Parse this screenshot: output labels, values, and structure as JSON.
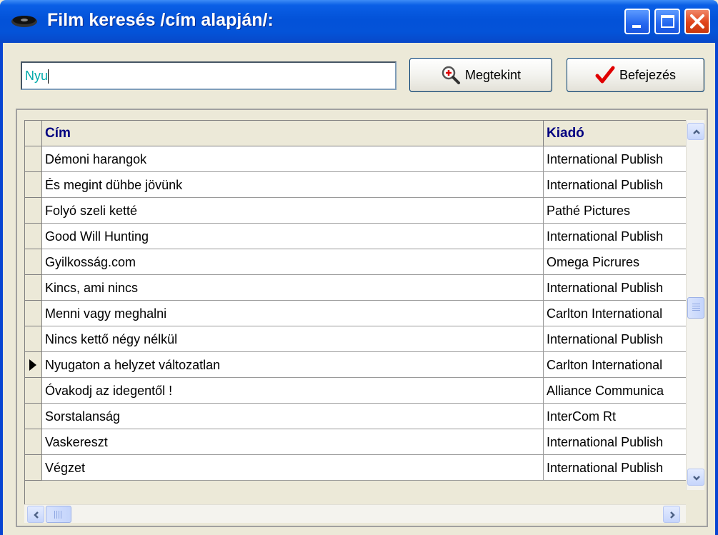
{
  "window": {
    "title": "Film keresés /cím alapján/:",
    "icons": {
      "app": "film-reel-icon",
      "minimize": "minimize-icon",
      "maximize": "maximize-icon",
      "close": "close-icon"
    }
  },
  "search": {
    "value": "Nyu"
  },
  "buttons": {
    "view_label": "Megtekint",
    "view_icon": "magnifier-icon",
    "done_label": "Befejezés",
    "done_icon": "checkmark-icon"
  },
  "table": {
    "columns": [
      "Cím",
      "Kiadó"
    ],
    "rows": [
      {
        "cim": "Démoni harangok",
        "kiado": "International Publish"
      },
      {
        "cim": "És megint dühbe jövünk",
        "kiado": "International Publish"
      },
      {
        "cim": "Folyó szeli ketté",
        "kiado": "Pathé Pictures"
      },
      {
        "cim": "Good Will Hunting",
        "kiado": "International Publish"
      },
      {
        "cim": "Gyilkosság.com",
        "kiado": "Omega Picrures"
      },
      {
        "cim": "Kincs, ami nincs",
        "kiado": "International Publish"
      },
      {
        "cim": "Menni vagy meghalni",
        "kiado": "Carlton International"
      },
      {
        "cim": "Nincs kettő négy nélkül",
        "kiado": "International Publish"
      },
      {
        "cim": "Nyugaton a helyzet változatlan",
        "kiado": "Carlton International"
      },
      {
        "cim": "Óvakodj az idegentől !",
        "kiado": "Alliance Communica"
      },
      {
        "cim": "Sorstalanság",
        "kiado": "InterCom Rt"
      },
      {
        "cim": "Vaskereszt",
        "kiado": "International Publish"
      },
      {
        "cim": "Végzet",
        "kiado": "International Publish"
      }
    ],
    "selected_row": 8
  },
  "colors": {
    "titlebar": "#0352d8",
    "header_text": "#000080",
    "window_bg": "#ece9d8",
    "input_text": "#00aaaa"
  }
}
